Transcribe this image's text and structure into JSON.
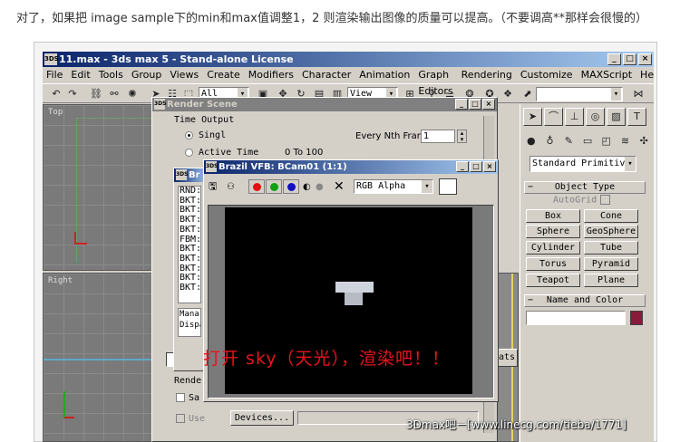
{
  "caption": "对了，如果把 image sample下的min和max值调整1，2 则渲染输出图像的质量可以提高。（不要调高**那样会很慢的）",
  "max_window": {
    "app_icon": "3DS",
    "title": "11.max - 3ds max 5 - Stand-alone License",
    "menu": [
      "File",
      "Edit",
      "Tools",
      "Group",
      "Views",
      "Create",
      "Modifiers",
      "Character",
      "Animation",
      "Graph Editors",
      "Rendering",
      "Customize",
      "MAXScript",
      "Help"
    ],
    "toolbar": {
      "selection_filter": "All",
      "ref_coord": "View"
    }
  },
  "viewports": {
    "top_label": "Top",
    "right_label": "Right"
  },
  "command_panel": {
    "category": "Standard Primitiv",
    "object_type_header": "Object Type",
    "autogrid_label": "AutoGrid",
    "objects": [
      "Box",
      "Cone",
      "Sphere",
      "GeoSphere",
      "Cylinder",
      "Tube",
      "Torus",
      "Pyramid",
      "Teapot",
      "Plane"
    ],
    "name_color_header": "Name and Color",
    "object_color": "#8a1a3a"
  },
  "render_scene": {
    "title": "Render Scene",
    "group_time_output": "Time Output",
    "single_label": "Singl",
    "active_time_label": "Active Time",
    "active_time_range": "0 To 100",
    "every_nth_label": "Every Nth Frame:",
    "every_nth_value": "1",
    "render_group_label": "Rende",
    "save_label": "Sa",
    "use_label": "Use",
    "devices_button": "Devices...",
    "stats_button": "ats"
  },
  "brazil_console": {
    "title_fragment": "Br",
    "lines": [
      "RND:",
      "BKT:",
      "BKT:",
      "BKT:",
      "BKT:",
      "FBM:",
      "BKT:",
      "BKT:",
      "BKT:",
      "BKT:",
      "BKT:"
    ],
    "footer_lines": [
      "Mana",
      "Dispa"
    ]
  },
  "vfb": {
    "title": "Brazil VFB: BCam01 (1:1)",
    "channel": "RGB Alpha",
    "colors": {
      "red": "#e01010",
      "green": "#10a010",
      "blue": "#1010c0"
    }
  },
  "overlay_text": "打开 sky（天光），渲染吧！！",
  "watermark": "3Dmax吧－[www.linecg.com/tieba/1771]"
}
